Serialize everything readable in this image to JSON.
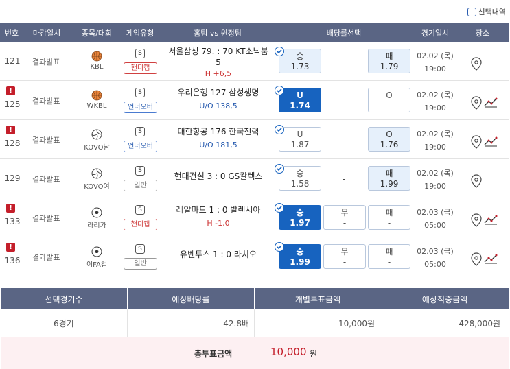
{
  "top": {
    "selection_nav": "선택내역"
  },
  "headers": [
    "번호",
    "마감일시",
    "종목/대회",
    "게임유형",
    "홈팀 vs 원정팀",
    "배당률선택",
    "경기일시",
    "장소"
  ],
  "rows": [
    {
      "num": "121",
      "alert": false,
      "status": "결과발표",
      "sport": "basketball",
      "league": "KBL",
      "game_type": "핸디캡",
      "gt_style": "red",
      "home": "서울삼성",
      "home_score": "79.",
      "away_score": "70",
      "away": "KT소닉붐",
      "away_wrap": "5",
      "sub": "H +6,5",
      "sub_style": "red",
      "opt1": {
        "label": "승",
        "value": "1.73",
        "state": "light",
        "check": true
      },
      "mid": "-",
      "opt3": {
        "label": "패",
        "value": "1.79",
        "state": "light",
        "check": false
      },
      "date": "02.02 (목)",
      "time": "19:00",
      "graph": false
    },
    {
      "num": "125",
      "alert": true,
      "status": "결과발표",
      "sport": "basketball",
      "league": "WKBL",
      "game_type": "언더오버",
      "gt_style": "blue",
      "home": "우리은행",
      "score": "127",
      "away": "삼성생명",
      "sub": "U/O 138,5",
      "sub_style": "blue",
      "opt1": {
        "label": "U",
        "value": "1.74",
        "state": "sel",
        "check": true
      },
      "mid": "",
      "opt3": {
        "label": "O",
        "value": "-",
        "state": "plain",
        "check": false
      },
      "date": "02.02 (목)",
      "time": "19:00",
      "graph": true
    },
    {
      "num": "128",
      "alert": true,
      "status": "결과발표",
      "sport": "volleyball",
      "league": "KOVO남",
      "game_type": "언더오버",
      "gt_style": "blue",
      "home": "대한항공",
      "score": "176",
      "away": "한국전력",
      "sub": "U/O 181,5",
      "sub_style": "blue",
      "opt1": {
        "label": "U",
        "value": "1.87",
        "state": "plain",
        "check": true
      },
      "mid": "",
      "opt3": {
        "label": "O",
        "value": "1.76",
        "state": "light",
        "check": false
      },
      "date": "02.02 (목)",
      "time": "19:00",
      "graph": true
    },
    {
      "num": "129",
      "alert": false,
      "status": "결과발표",
      "sport": "volleyball",
      "league": "KOVO여",
      "game_type": "일반",
      "gt_style": "gray",
      "home": "현대건설",
      "score": "3 : 0",
      "away": "GS칼텍스",
      "sub": "",
      "sub_style": "",
      "opt1": {
        "label": "승",
        "value": "1.58",
        "state": "plain",
        "check": true
      },
      "mid": "-",
      "opt3": {
        "label": "패",
        "value": "1.99",
        "state": "light",
        "check": false
      },
      "date": "02.02 (목)",
      "time": "19:00",
      "graph": false
    },
    {
      "num": "133",
      "alert": true,
      "status": "결과발표",
      "sport": "soccer",
      "league": "라리가",
      "game_type": "핸디캡",
      "gt_style": "red",
      "home": "레알마드",
      "score": "1 : 0",
      "away": "발렌시아",
      "sub": "H -1,0",
      "sub_style": "red",
      "opt1": {
        "label": "승",
        "value": "1.97",
        "state": "sel",
        "check": true
      },
      "opt2": {
        "label": "무",
        "value": "-"
      },
      "opt3": {
        "label": "패",
        "value": "-",
        "state": "plain",
        "check": false
      },
      "date": "02.03 (금)",
      "time": "05:00",
      "graph": true
    },
    {
      "num": "136",
      "alert": true,
      "status": "결과발표",
      "sport": "soccer",
      "league": "이FA컵",
      "game_type": "일반",
      "gt_style": "gray",
      "home": "유벤투스",
      "score": "1 : 0",
      "away": "라치오",
      "sub": "",
      "sub_style": "",
      "opt1": {
        "label": "승",
        "value": "1.99",
        "state": "sel",
        "check": true
      },
      "opt2": {
        "label": "무",
        "value": "-"
      },
      "opt3": {
        "label": "패",
        "value": "-",
        "state": "plain",
        "check": false
      },
      "date": "02.03 (금)",
      "time": "05:00",
      "graph": true
    }
  ],
  "summary": {
    "headers": [
      "선택경기수",
      "예상배당률",
      "개별투표금액",
      "예상적중금액"
    ],
    "values": [
      "6경기",
      "42.8배",
      "10,000원",
      "428,000원"
    ],
    "total_label": "총투표금액",
    "total_amount": "10,000",
    "total_unit": "원"
  },
  "colors": {
    "header_bg": "#5a6584",
    "selected": "#1763bf",
    "light": "#e6f0fb",
    "alert": "#c41e2a",
    "total_bg": "#fdf0f2"
  }
}
